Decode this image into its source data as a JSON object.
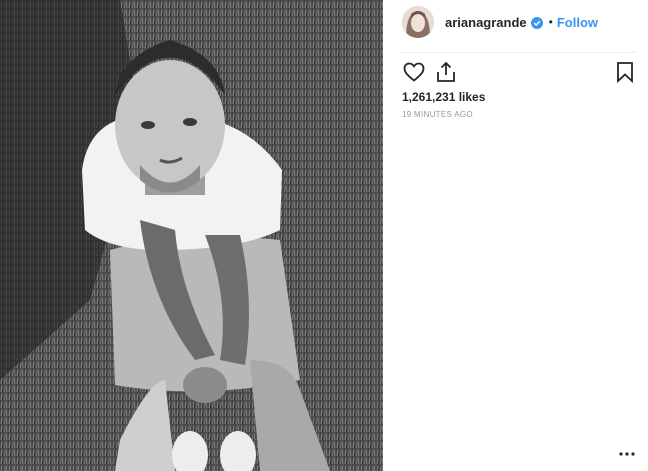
{
  "post": {
    "image_description_icon": "photo",
    "username": "arianagrande",
    "verified_icon": "verified-badge-icon",
    "separator": "•",
    "follow_label": "Follow",
    "likes_text": "1,261,231 likes",
    "timestamp": "19 MINUTES AGO"
  },
  "icons": {
    "like": "heart-icon",
    "share": "share-icon",
    "save": "bookmark-icon",
    "more": "more-options-icon"
  },
  "colors": {
    "accent": "#3897f0",
    "text": "#262626",
    "muted": "#999999"
  }
}
